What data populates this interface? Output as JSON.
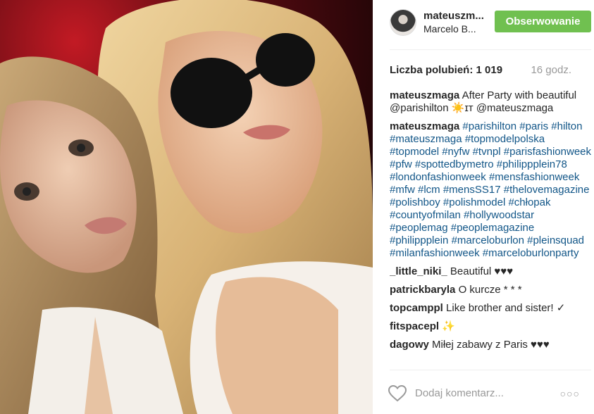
{
  "post": {
    "author": {
      "username": "mateuszm...",
      "location": "Marcelo B..."
    },
    "follow_button": "Obserwowanie",
    "likes": "Liczba polubień: 1 019",
    "time": "16 godz.",
    "comments": [
      {
        "user": "mateuszmaga",
        "text": "After Party with beautiful @parishilton ☀️ɪᴛ @mateuszmaga",
        "style": "plain"
      },
      {
        "user": "mateuszmaga",
        "text": "#parishilton #paris #hilton #mateuszmaga #topmodelpolska #topmodel #nyfw #tvnpl #parisfashionweek #pfw #spottedbymetro #philippplein78 #londonfashionweek #mensfashionweek #mfw #lcm #mensSS17 #thelovemagazine #polishboy #polishmodel #chłopak #countyofmilan #hollywoodstar #peoplemag #peoplemagazine #philippplein #marceloburlon #pleinsquad #milanfashionweek #marceloburlonparty",
        "style": "link"
      },
      {
        "user": "_little_niki_",
        "text": "Beautiful ♥♥♥",
        "style": "plain"
      },
      {
        "user": "patrickbaryla",
        "text": "O kurcze * * *",
        "style": "plain"
      },
      {
        "user": "topcamppl",
        "text": "Like brother and sister! ✓",
        "style": "plain"
      },
      {
        "user": "fitspacepl",
        "text": "✨",
        "style": "plain"
      },
      {
        "user": "dagowy",
        "text": "Miłej zabawy z Paris ♥♥♥",
        "style": "plain"
      }
    ],
    "comment_placeholder": "Dodaj komentarz...",
    "more_label": "○○○"
  },
  "icons": {
    "heart": "heart-outline-icon",
    "more": "more-options-icon"
  },
  "colors": {
    "follow_button": "#70c050",
    "link": "#125688",
    "muted": "#999999"
  }
}
